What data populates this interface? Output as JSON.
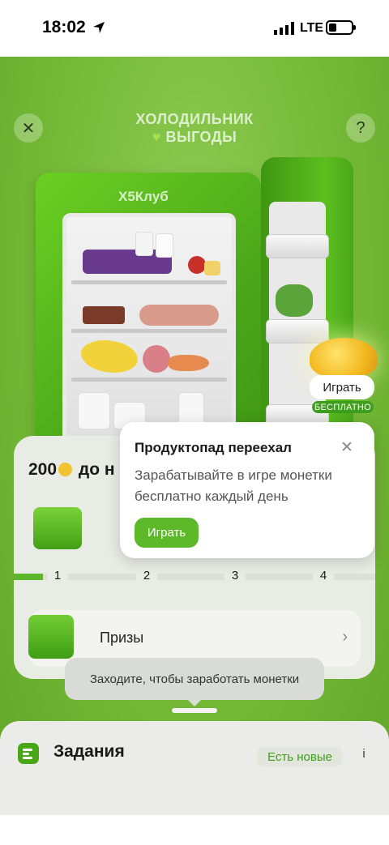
{
  "status_bar": {
    "time": "18:02",
    "network": "LTE"
  },
  "game": {
    "title_line1": "ХОЛОДИЛЬНИК",
    "title_line2": "ВЫГОДЫ",
    "brand_logo": "Х5Клуб"
  },
  "play_badge": {
    "label": "Играть",
    "tag": "БЕСПЛАТНО"
  },
  "progress": {
    "title_amount": "200",
    "title_suffix": "до н",
    "steps": [
      "1",
      "2",
      "3",
      "4"
    ],
    "fill_fraction": 0.08,
    "prizes_label": "Призы"
  },
  "toast": {
    "text": "Заходите, чтобы заработать монетки"
  },
  "tasks": {
    "title": "Задания",
    "badge": "Есть новые",
    "info": "i"
  },
  "popup": {
    "title": "Продуктопад переехал",
    "text": "Зарабатывайте в игре монетки бесплатно каждый день",
    "button": "Играть"
  },
  "colors": {
    "accent_green": "#5db82a",
    "background_green": "#74b936",
    "coin_yellow": "#f2c230"
  },
  "icons": {
    "close": "close-icon",
    "help": "question-icon",
    "chevron": "chevron-right-icon",
    "location": "location-arrow-icon"
  }
}
